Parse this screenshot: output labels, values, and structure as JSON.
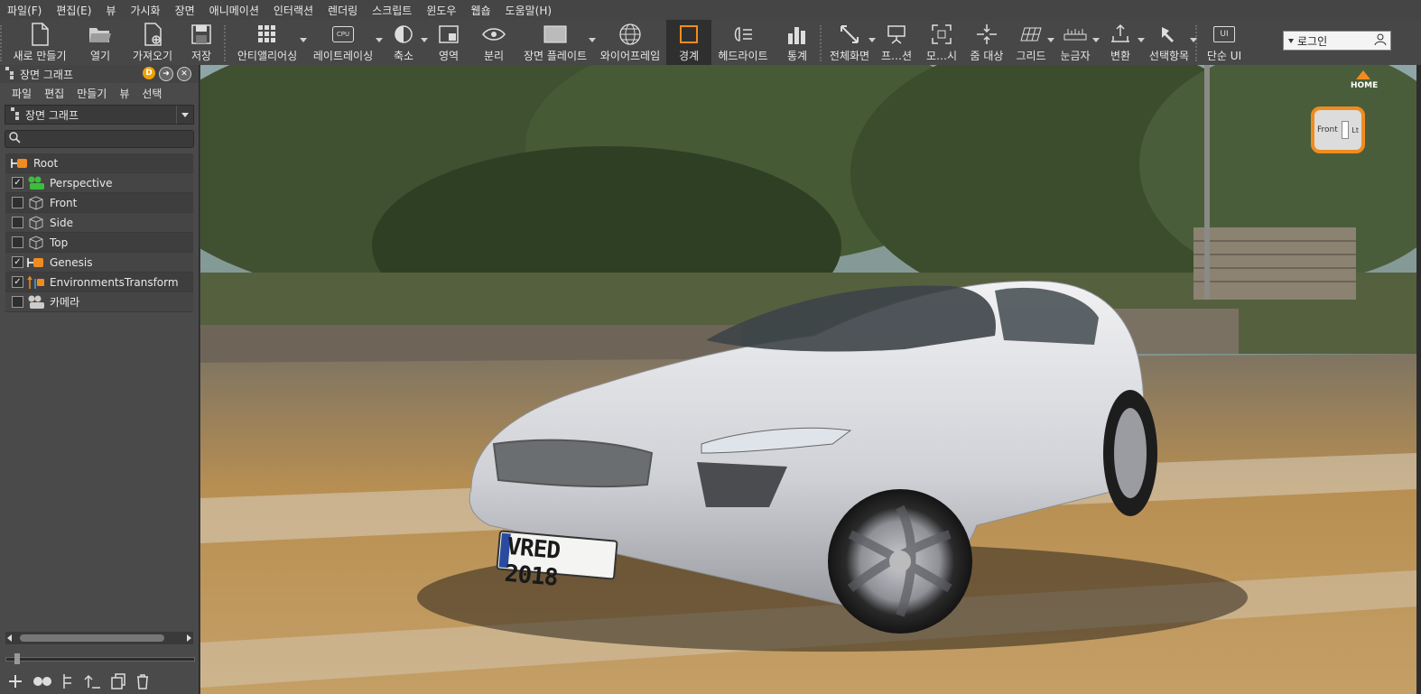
{
  "menubar": {
    "items": [
      "파일(F)",
      "편집(E)",
      "뷰",
      "가시화",
      "장면",
      "애니메이션",
      "인터랙션",
      "렌더링",
      "스크립트",
      "윈도우",
      "웹숍",
      "도움말(H)"
    ]
  },
  "toolbar": {
    "new": "새로 만들기",
    "open": "열기",
    "import": "가져오기",
    "save": "저장",
    "antialiasing": "안티앨리어싱",
    "raytracing": "레이트레이싱",
    "cpu_badge": "CPU",
    "axis": "축소",
    "region": "영역",
    "isolate": "분리",
    "scene_plate": "장면 플레이트",
    "wireframe": "와이어프레임",
    "bounds": "경계",
    "headlight": "헤드라이트",
    "stats": "통계",
    "fullscreen": "전체화면",
    "frame": "프…션",
    "mode": "모…시",
    "zoom_target": "줌 대상",
    "grid": "그리드",
    "ruler": "눈금자",
    "transform": "변환",
    "selection": "선택항목",
    "simple_ui": "단순 UI",
    "ui_badge": "UI",
    "login": "로그인"
  },
  "scenegraph": {
    "title": "장면 그래프",
    "menu": [
      "파일",
      "편집",
      "만들기",
      "뷰",
      "선택"
    ],
    "combo": "장면 그래프",
    "search_placeholder": "",
    "nodes": [
      {
        "label": "Root",
        "checkbox": false,
        "checked": false,
        "icon": "root-icon"
      },
      {
        "label": "Perspective",
        "checkbox": true,
        "checked": true,
        "icon": "camera-group-icon"
      },
      {
        "label": "Front",
        "checkbox": true,
        "checked": false,
        "icon": "cube-icon"
      },
      {
        "label": "Side",
        "checkbox": true,
        "checked": false,
        "icon": "cube-icon"
      },
      {
        "label": "Top",
        "checkbox": true,
        "checked": false,
        "icon": "cube-icon"
      },
      {
        "label": "Genesis",
        "checkbox": true,
        "checked": true,
        "icon": "group-icon"
      },
      {
        "label": "EnvironmentsTransform",
        "checkbox": true,
        "checked": true,
        "icon": "transform-icon"
      },
      {
        "label": "카메라",
        "checkbox": true,
        "checked": false,
        "icon": "camera-icon"
      }
    ]
  },
  "viewport": {
    "license_plate": "VRED 2018",
    "navcube_home": "HOME",
    "navcube_front": "Front",
    "navcube_left": "Lt"
  }
}
